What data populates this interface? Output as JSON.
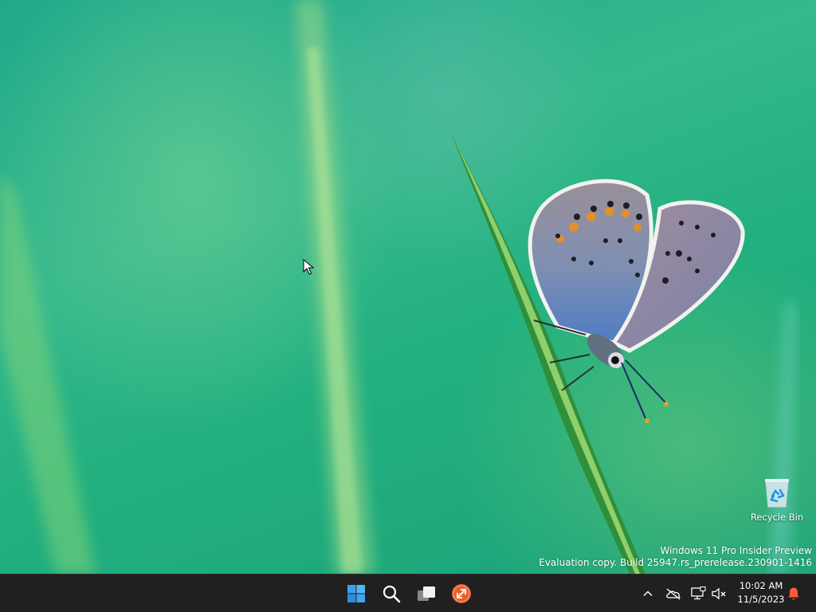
{
  "desktop": {
    "watermark": {
      "line1": "Windows 11 Pro Insider Preview",
      "line2": "Evaluation copy. Build 25947.rs_prerelease.230901-1416"
    },
    "icons": [
      {
        "label": "Recycle Bin",
        "icon": "recycle-bin-icon"
      }
    ]
  },
  "taskbar": {
    "apps": [
      {
        "name": "start",
        "icon": "windows-logo-icon"
      },
      {
        "name": "search",
        "icon": "search-icon"
      },
      {
        "name": "task-view",
        "icon": "task-view-icon"
      },
      {
        "name": "remote-app",
        "icon": "remote-connection-icon"
      }
    ],
    "tray": {
      "overflow_icon": "chevron-up-icon",
      "icons": [
        "onedrive-offline-icon",
        "network-icon",
        "volume-muted-icon",
        "notification-bell-icon"
      ],
      "time": "10:02 AM",
      "date": "11/5/2023"
    }
  },
  "colors": {
    "taskbar_bg": "#202020",
    "start_blue": "#3a9ff0",
    "remote_orange": "#e8602c",
    "notification_red": "#ff5a3c"
  }
}
